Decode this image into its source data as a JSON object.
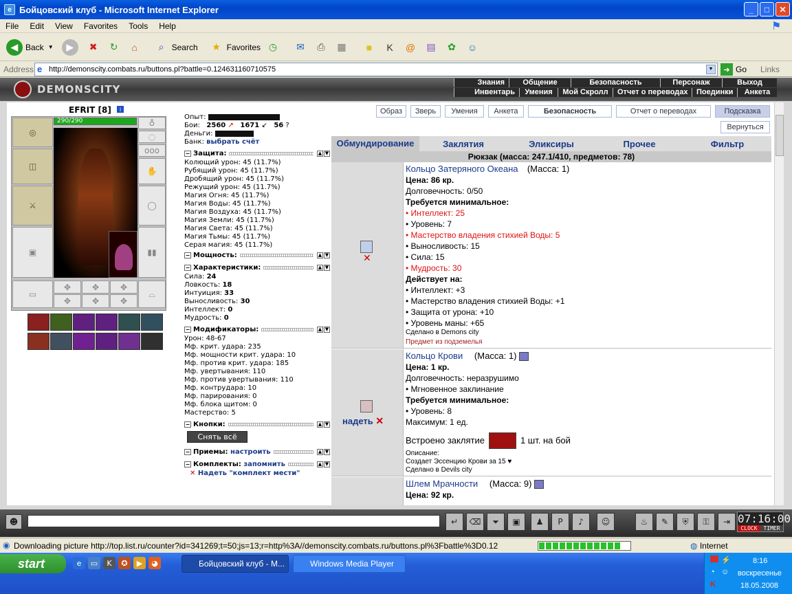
{
  "window": {
    "title": "Бойцовский клуб - Microsoft Internet Explorer",
    "min": "_",
    "max": "□",
    "close": "✕"
  },
  "menu": [
    "File",
    "Edit",
    "View",
    "Favorites",
    "Tools",
    "Help"
  ],
  "toolbar": {
    "back": "Back",
    "search": "Search",
    "favorites": "Favorites"
  },
  "address": {
    "label": "Address",
    "url": "http://demonscity.combats.ru/buttons.pl?battle=0.124631160710575",
    "go": "Go",
    "links": "Links"
  },
  "site": {
    "logo": "DEMONSCITY",
    "nav_top": [
      "Знания",
      "Общение",
      "Безопасность",
      "Персонаж",
      "Выход"
    ],
    "nav_bottom": [
      "Инвентарь",
      "Умения",
      "Мой Скролл",
      "Отчет о переводах",
      "Поединки",
      "Анкета"
    ]
  },
  "character": {
    "name": "EFRIT",
    "level": "[8]",
    "hp": "290/290",
    "hp_fraction": 1.0
  },
  "stats": {
    "exp_label": "Опыт:",
    "fights_label": "Бои:",
    "fights_win": "2560",
    "fights_lose": "1671",
    "fights_draw": "56",
    "money_label": "Деньги:",
    "bank_label": "Банк:",
    "bank_link": "выбрать счёт",
    "defense_title": "Защита:",
    "defense": [
      "Колющий урон: 45 (11.7%)",
      "Рубящий урон: 45 (11.7%)",
      "Дробящий урон: 45 (11.7%)",
      "Режущий урон: 45 (11.7%)",
      "Магия Огня: 45 (11.7%)",
      "Магия Воды: 45 (11.7%)",
      "Магия Воздуха: 45 (11.7%)",
      "Магия Земли: 45 (11.7%)",
      "Магия Света: 45 (11.7%)",
      "Магия Тьмы: 45 (11.7%)",
      "Серая магия: 45 (11.7%)"
    ],
    "power_title": "Мощность:",
    "char_title": "Характеристики:",
    "chars": [
      {
        "label": "Сила:",
        "value": "24"
      },
      {
        "label": "Ловкость:",
        "value": "18"
      },
      {
        "label": "Интуиция:",
        "value": "33"
      },
      {
        "label": "Выносливость:",
        "value": "30"
      },
      {
        "label": "Интеллект:",
        "value": "0"
      },
      {
        "label": "Мудрость:",
        "value": "0"
      }
    ],
    "mod_title": "Модификаторы:",
    "mods": [
      "Урон: 48-67",
      "Мф. крит. удара: 235",
      "Мф. мощности крит. удара: 10",
      "Мф. против крит. удара: 185",
      "Мф. увертывания: 110",
      "Мф. против увертывания: 110",
      "Мф. контрудара: 10",
      "Мф. парирования: 0",
      "Мф. блока щитом: 0",
      "Мастерство: 5"
    ],
    "buttons_title": "Кнопки:",
    "remove_all": "Снять всё",
    "tricks_title": "Приемы:",
    "tricks_link": "настроить",
    "sets_title": "Комплекты:",
    "sets_link": "запомнить",
    "set_item": "Надеть \"комплект мести\""
  },
  "top_buttons": [
    "Образ",
    "Зверь",
    "Умения",
    "Анкета",
    "Безопасность",
    "Отчет о переводах",
    "Подсказка",
    "Вернуться"
  ],
  "tabs": [
    "Обмундирование",
    "Заклятия",
    "Эликсиры",
    "Прочее",
    "Фильтр"
  ],
  "bag_title": "Рюкзак (масса: 247.1/410, предметов: 78)",
  "items": [
    {
      "name": "Кольцо Затеряного Океана",
      "mass": "(Масса: 1)",
      "price": "Цена: 86 кр.",
      "durability": "Долговечность: 0/50",
      "req_title": "Требуется минимальное:",
      "reqs": [
        {
          "text": "• Интеллект: 25",
          "red": true
        },
        {
          "text": "• Уровень: 7",
          "red": false
        },
        {
          "text": "• Мастерство владения стихией Воды: 5",
          "red": true
        },
        {
          "text": "• Выносливость: 15",
          "red": false
        },
        {
          "text": "• Сила: 15",
          "red": false
        },
        {
          "text": "• Мудрость: 30",
          "red": true
        }
      ],
      "effect_title": "Действует на:",
      "effects": [
        "• Интеллект: +3",
        "• Мастерство владения стихией Воды: +1",
        "• Защита от урона: +10",
        "• Уровень маны: +65"
      ],
      "made": "Сделано в Demons city",
      "origin": "Предмет из подземелья"
    },
    {
      "name": "Кольцо Крови",
      "mass": "(Масса: 1)",
      "price": "Цена: 1 кр.",
      "durability": "Долговечность: неразрушимо",
      "spell": "• Мгновенное заклинание",
      "req_title": "Требуется минимальное:",
      "req": "• Уровень: 8",
      "max": "Максимум: 1 ед.",
      "built_in": "Встроено заклятие",
      "built_in_count": "1 шт. на бой",
      "desc_title": "Описание:",
      "desc": "Создает Эссенцию Крови за 15 ♥",
      "made": "Сделано в Devils city",
      "wear": "надеть"
    },
    {
      "name": "Шлем Мрачности",
      "mass": "(Масса: 9)",
      "price": "Цена: 92 кр."
    }
  ],
  "clock": {
    "time": "07:16:00",
    "clock_label": "CLOCK",
    "timer_label": "TIMER"
  },
  "status": {
    "text": "Downloading picture http://top.list.ru/counter?id=341269;t=50;js=13;r=http%3A//demonscity.combats.ru/buttons.pl%3Fbattle%3D0.12",
    "progress": 0.9,
    "zone": "Internet"
  },
  "taskbar": {
    "start": "start",
    "tasks": [
      "Бойцовский клуб - M...",
      "Windows Media Player"
    ],
    "time": "8:16",
    "day": "воскресенье",
    "date": "18.05.2008"
  },
  "colors": {
    "accent": "#1a3a8a",
    "warn": "#e01010",
    "hp": "#1ca81c"
  }
}
